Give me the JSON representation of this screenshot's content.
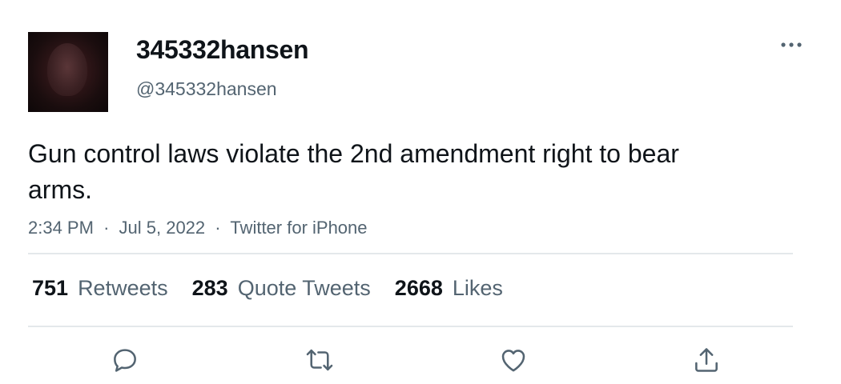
{
  "author": {
    "display_name": "345332hansen",
    "handle": "@345332hansen"
  },
  "tweet": {
    "text": "Gun control laws violate the 2nd amendment right to bear arms.",
    "time": "2:34 PM",
    "date": "Jul 5, 2022",
    "source": "Twitter for iPhone",
    "separator": "·"
  },
  "stats": {
    "retweets_count": "751",
    "retweets_label": "Retweets",
    "quotes_count": "283",
    "quotes_label": "Quote Tweets",
    "likes_count": "2668",
    "likes_label": "Likes"
  },
  "icons": {
    "more": "more-horizontal-icon",
    "reply": "reply-icon",
    "retweet": "retweet-icon",
    "like": "heart-icon",
    "share": "share-icon"
  },
  "colors": {
    "text_primary": "#0f1419",
    "text_secondary": "#536471",
    "divider": "#e4e8eb",
    "background": "#ffffff"
  }
}
